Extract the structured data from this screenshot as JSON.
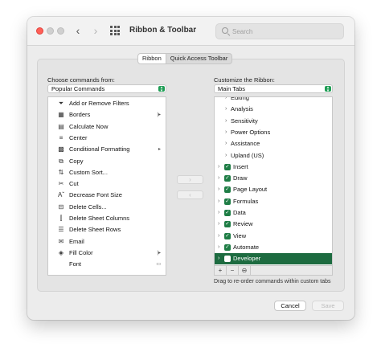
{
  "window": {
    "title": "Ribbon & Toolbar"
  },
  "search": {
    "placeholder": "Search"
  },
  "segments": [
    "Ribbon",
    "Quick Access Toolbar"
  ],
  "left": {
    "label": "Choose commands from:",
    "popup_value": "Popular Commands",
    "items": [
      {
        "label": "Add or Remove Filters",
        "icon": "filter-icon",
        "glyph": "⏷",
        "sub": ""
      },
      {
        "label": "Borders",
        "icon": "borders-icon",
        "glyph": "▦",
        "sub": "|▸"
      },
      {
        "label": "Calculate Now",
        "icon": "calculator-icon",
        "glyph": "▤",
        "sub": ""
      },
      {
        "label": "Center",
        "icon": "center-align-icon",
        "glyph": "≡",
        "sub": ""
      },
      {
        "label": "Conditional Formatting",
        "icon": "conditional-formatting-icon",
        "glyph": "▩",
        "sub": "▸"
      },
      {
        "label": "Copy",
        "icon": "copy-icon",
        "glyph": "⧉",
        "sub": ""
      },
      {
        "label": "Custom Sort...",
        "icon": "sort-icon",
        "glyph": "⇅",
        "sub": ""
      },
      {
        "label": "Cut",
        "icon": "scissors-icon",
        "glyph": "✂",
        "sub": ""
      },
      {
        "label": "Decrease Font Size",
        "icon": "decrease-font-icon",
        "glyph": "Aˇ",
        "sub": ""
      },
      {
        "label": "Delete Cells...",
        "icon": "delete-cells-icon",
        "glyph": "⊟",
        "sub": ""
      },
      {
        "label": "Delete Sheet Columns",
        "icon": "delete-columns-icon",
        "glyph": "⫿",
        "sub": ""
      },
      {
        "label": "Delete Sheet Rows",
        "icon": "delete-rows-icon",
        "glyph": "☰",
        "sub": ""
      },
      {
        "label": "Email",
        "icon": "email-icon",
        "glyph": "✉",
        "sub": ""
      },
      {
        "label": "Fill Color",
        "icon": "fill-color-icon",
        "glyph": "◈",
        "sub": "|▸"
      },
      {
        "label": "Font",
        "icon": "font-icon",
        "glyph": "",
        "sub": "▭"
      }
    ]
  },
  "right": {
    "label": "Customize the Ribbon:",
    "popup_value": "Main Tabs",
    "items": [
      {
        "label": "Editing",
        "level": 2,
        "checked": null,
        "selected": false
      },
      {
        "label": "Analysis",
        "level": 2,
        "checked": null,
        "selected": false
      },
      {
        "label": "Sensitivity",
        "level": 2,
        "checked": null,
        "selected": false
      },
      {
        "label": "Power Options",
        "level": 2,
        "checked": null,
        "selected": false
      },
      {
        "label": "Assistance",
        "level": 2,
        "checked": null,
        "selected": false
      },
      {
        "label": "Upland (US)",
        "level": 2,
        "checked": null,
        "selected": false
      },
      {
        "label": "Insert",
        "level": 1,
        "checked": true,
        "selected": false
      },
      {
        "label": "Draw",
        "level": 1,
        "checked": true,
        "selected": false
      },
      {
        "label": "Page Layout",
        "level": 1,
        "checked": true,
        "selected": false
      },
      {
        "label": "Formulas",
        "level": 1,
        "checked": true,
        "selected": false
      },
      {
        "label": "Data",
        "level": 1,
        "checked": true,
        "selected": false
      },
      {
        "label": "Review",
        "level": 1,
        "checked": true,
        "selected": false
      },
      {
        "label": "View",
        "level": 1,
        "checked": true,
        "selected": false
      },
      {
        "label": "Automate",
        "level": 1,
        "checked": true,
        "selected": false
      },
      {
        "label": "Developer",
        "level": 1,
        "checked": false,
        "selected": true
      }
    ],
    "bottom_buttons": [
      "+",
      "−",
      "⊖"
    ],
    "hint": "Drag to re-order commands within custom tabs"
  },
  "move": {
    "add": "›",
    "remove": "‹"
  },
  "footer": {
    "cancel": "Cancel",
    "save": "Save"
  },
  "colors": {
    "accent": "#1e7d45",
    "selected_row": "#1d6b40",
    "close": "#ff5f57"
  }
}
